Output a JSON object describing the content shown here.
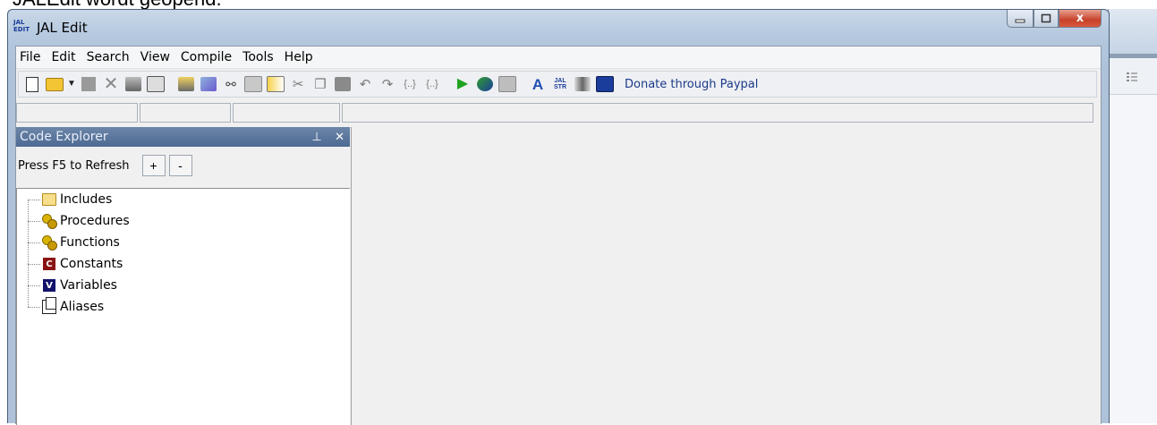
{
  "caption": "JALEdit wordt geopend.",
  "window": {
    "title": "JAL Edit",
    "icon_text": "JAL EDIT",
    "close_glyph": "x"
  },
  "menu": [
    "File",
    "Edit",
    "Search",
    "View",
    "Compile",
    "Tools",
    "Help"
  ],
  "toolbar": {
    "donate_label": "Donate through Paypal"
  },
  "code_explorer": {
    "title": "Code Explorer",
    "refresh_label": "Press F5 to Refresh",
    "expand_label": "+",
    "collapse_label": "-",
    "tree": [
      "Includes",
      "Procedures",
      "Functions",
      "Constants",
      "Variables",
      "Aliases"
    ],
    "constants_badge": "C",
    "variables_badge": "V"
  },
  "icons": {
    "title_close": "close-icon",
    "pin": "pin-icon",
    "panel_close": "close-icon"
  },
  "colors": {
    "panel_title_bg": "#5a7499",
    "close_button": "#c8412a",
    "donate_link": "#1b3a8a"
  }
}
